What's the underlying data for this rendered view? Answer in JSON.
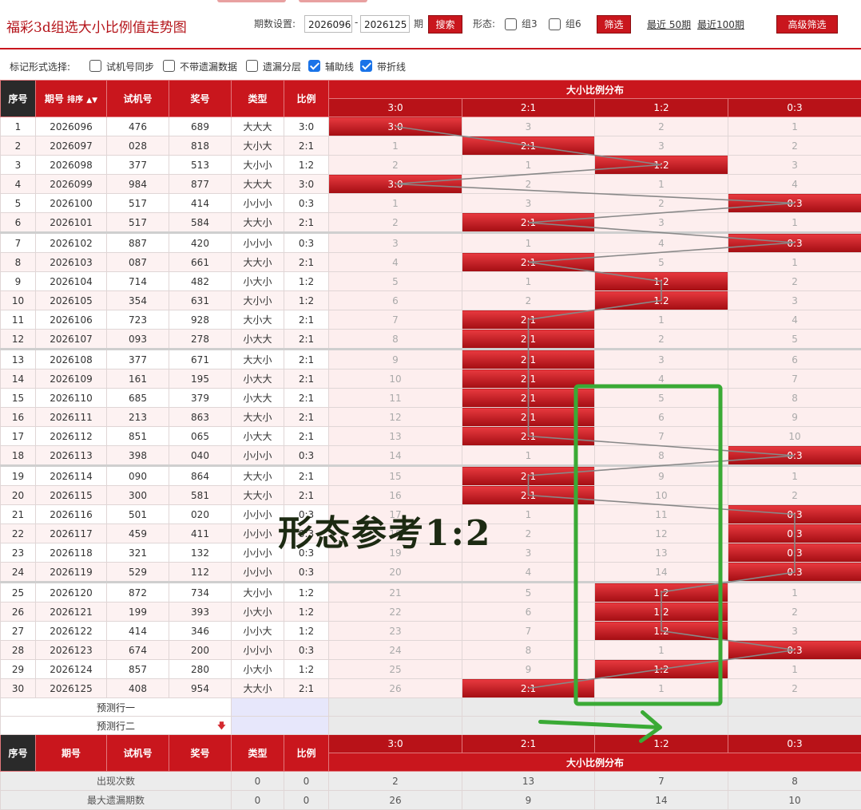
{
  "header": {
    "title": "福彩3d组选大小比例值走势图",
    "period_label": "期数设置:",
    "period_from": "2026096",
    "period_to": "2026125",
    "period_unit": "期",
    "search_label": "搜索",
    "shape_label": "形态:",
    "group3_label": "组3",
    "group6_label": "组6",
    "filter_label": "筛选",
    "recent50": "最近 50期",
    "recent100": "最近100期",
    "advanced_label": "高级筛选"
  },
  "mark_options": {
    "label": "标记形式选择:",
    "items": [
      {
        "label": "试机号同步",
        "checked": false
      },
      {
        "label": "不带遗漏数据",
        "checked": false
      },
      {
        "label": "遗漏分层",
        "checked": false
      },
      {
        "label": "辅助线",
        "checked": true
      },
      {
        "label": "带折线",
        "checked": true
      }
    ]
  },
  "columns": {
    "seq": "序号",
    "period": "期号",
    "sort": "排序",
    "trial": "试机号",
    "draw": "奖号",
    "type": "类型",
    "ratio": "比例",
    "dist": "大小比例分布",
    "ratios": [
      "3:0",
      "2:1",
      "1:2",
      "0:3"
    ]
  },
  "rows": [
    {
      "seq": "1",
      "period": "2026096",
      "trial": "476",
      "draw": "689",
      "type": "大大大",
      "ratio": "3:0",
      "cells": [
        "3:0",
        "3",
        "2",
        "1"
      ],
      "hit": 0
    },
    {
      "seq": "2",
      "period": "2026097",
      "trial": "028",
      "draw": "818",
      "type": "大小大",
      "ratio": "2:1",
      "cells": [
        "1",
        "2:1",
        "3",
        "2"
      ],
      "hit": 1
    },
    {
      "seq": "3",
      "period": "2026098",
      "trial": "377",
      "draw": "513",
      "type": "大小小",
      "ratio": "1:2",
      "cells": [
        "2",
        "1",
        "1:2",
        "3"
      ],
      "hit": 2
    },
    {
      "seq": "4",
      "period": "2026099",
      "trial": "984",
      "draw": "877",
      "type": "大大大",
      "ratio": "3:0",
      "cells": [
        "3:0",
        "2",
        "1",
        "4"
      ],
      "hit": 0
    },
    {
      "seq": "5",
      "period": "2026100",
      "trial": "517",
      "draw": "414",
      "type": "小小小",
      "ratio": "0:3",
      "cells": [
        "1",
        "3",
        "2",
        "0:3"
      ],
      "hit": 3
    },
    {
      "seq": "6",
      "period": "2026101",
      "trial": "517",
      "draw": "584",
      "type": "大大小",
      "ratio": "2:1",
      "cells": [
        "2",
        "2:1",
        "3",
        "1"
      ],
      "hit": 1
    },
    {
      "seq": "7",
      "period": "2026102",
      "trial": "887",
      "draw": "420",
      "type": "小小小",
      "ratio": "0:3",
      "cells": [
        "3",
        "1",
        "4",
        "0:3"
      ],
      "hit": 3
    },
    {
      "seq": "8",
      "period": "2026103",
      "trial": "087",
      "draw": "661",
      "type": "大大小",
      "ratio": "2:1",
      "cells": [
        "4",
        "2:1",
        "5",
        "1"
      ],
      "hit": 1
    },
    {
      "seq": "9",
      "period": "2026104",
      "trial": "714",
      "draw": "482",
      "type": "小大小",
      "ratio": "1:2",
      "cells": [
        "5",
        "1",
        "1:2",
        "2"
      ],
      "hit": 2
    },
    {
      "seq": "10",
      "period": "2026105",
      "trial": "354",
      "draw": "631",
      "type": "大小小",
      "ratio": "1:2",
      "cells": [
        "6",
        "2",
        "1:2",
        "3"
      ],
      "hit": 2
    },
    {
      "seq": "11",
      "period": "2026106",
      "trial": "723",
      "draw": "928",
      "type": "大小大",
      "ratio": "2:1",
      "cells": [
        "7",
        "2:1",
        "1",
        "4"
      ],
      "hit": 1
    },
    {
      "seq": "12",
      "period": "2026107",
      "trial": "093",
      "draw": "278",
      "type": "小大大",
      "ratio": "2:1",
      "cells": [
        "8",
        "2:1",
        "2",
        "5"
      ],
      "hit": 1
    },
    {
      "seq": "13",
      "period": "2026108",
      "trial": "377",
      "draw": "671",
      "type": "大大小",
      "ratio": "2:1",
      "cells": [
        "9",
        "2:1",
        "3",
        "6"
      ],
      "hit": 1
    },
    {
      "seq": "14",
      "period": "2026109",
      "trial": "161",
      "draw": "195",
      "type": "小大大",
      "ratio": "2:1",
      "cells": [
        "10",
        "2:1",
        "4",
        "7"
      ],
      "hit": 1
    },
    {
      "seq": "15",
      "period": "2026110",
      "trial": "685",
      "draw": "379",
      "type": "小大大",
      "ratio": "2:1",
      "cells": [
        "11",
        "2:1",
        "5",
        "8"
      ],
      "hit": 1
    },
    {
      "seq": "16",
      "period": "2026111",
      "trial": "213",
      "draw": "863",
      "type": "大大小",
      "ratio": "2:1",
      "cells": [
        "12",
        "2:1",
        "6",
        "9"
      ],
      "hit": 1
    },
    {
      "seq": "17",
      "period": "2026112",
      "trial": "851",
      "draw": "065",
      "type": "小大大",
      "ratio": "2:1",
      "cells": [
        "13",
        "2:1",
        "7",
        "10"
      ],
      "hit": 1
    },
    {
      "seq": "18",
      "period": "2026113",
      "trial": "398",
      "draw": "040",
      "type": "小小小",
      "ratio": "0:3",
      "cells": [
        "14",
        "1",
        "8",
        "0:3"
      ],
      "hit": 3
    },
    {
      "seq": "19",
      "period": "2026114",
      "trial": "090",
      "draw": "864",
      "type": "大大小",
      "ratio": "2:1",
      "cells": [
        "15",
        "2:1",
        "9",
        "1"
      ],
      "hit": 1
    },
    {
      "seq": "20",
      "period": "2026115",
      "trial": "300",
      "draw": "581",
      "type": "大大小",
      "ratio": "2:1",
      "cells": [
        "16",
        "2:1",
        "10",
        "2"
      ],
      "hit": 1
    },
    {
      "seq": "21",
      "period": "2026116",
      "trial": "501",
      "draw": "020",
      "type": "小小小",
      "ratio": "0:3",
      "cells": [
        "17",
        "1",
        "11",
        "0:3"
      ],
      "hit": 3
    },
    {
      "seq": "22",
      "period": "2026117",
      "trial": "459",
      "draw": "411",
      "type": "小小小",
      "ratio": "0:3",
      "cells": [
        "18",
        "2",
        "12",
        "0:3"
      ],
      "hit": 3
    },
    {
      "seq": "23",
      "period": "2026118",
      "trial": "321",
      "draw": "132",
      "type": "小小小",
      "ratio": "0:3",
      "cells": [
        "19",
        "3",
        "13",
        "0:3"
      ],
      "hit": 3
    },
    {
      "seq": "24",
      "period": "2026119",
      "trial": "529",
      "draw": "112",
      "type": "小小小",
      "ratio": "0:3",
      "cells": [
        "20",
        "4",
        "14",
        "0:3"
      ],
      "hit": 3
    },
    {
      "seq": "25",
      "period": "2026120",
      "trial": "872",
      "draw": "734",
      "type": "大小小",
      "ratio": "1:2",
      "cells": [
        "21",
        "5",
        "1:2",
        "1"
      ],
      "hit": 2
    },
    {
      "seq": "26",
      "period": "2026121",
      "trial": "199",
      "draw": "393",
      "type": "小大小",
      "ratio": "1:2",
      "cells": [
        "22",
        "6",
        "1:2",
        "2"
      ],
      "hit": 2
    },
    {
      "seq": "27",
      "period": "2026122",
      "trial": "414",
      "draw": "346",
      "type": "小小大",
      "ratio": "1:2",
      "cells": [
        "23",
        "7",
        "1:2",
        "3"
      ],
      "hit": 2
    },
    {
      "seq": "28",
      "period": "2026123",
      "trial": "674",
      "draw": "200",
      "type": "小小小",
      "ratio": "0:3",
      "cells": [
        "24",
        "8",
        "1",
        "0:3"
      ],
      "hit": 3
    },
    {
      "seq": "29",
      "period": "2026124",
      "trial": "857",
      "draw": "280",
      "type": "小大小",
      "ratio": "1:2",
      "cells": [
        "25",
        "9",
        "1:2",
        "1"
      ],
      "hit": 2
    },
    {
      "seq": "30",
      "period": "2026125",
      "trial": "408",
      "draw": "954",
      "type": "大大小",
      "ratio": "2:1",
      "cells": [
        "26",
        "2:1",
        "1",
        "2"
      ],
      "hit": 1
    }
  ],
  "predict": [
    "预测行一",
    "预测行二"
  ],
  "stats": {
    "count_label": "出现次数",
    "count_values": [
      "0",
      "0",
      "2",
      "13",
      "7",
      "8"
    ],
    "maxmiss_label": "最大遗漏期数",
    "maxmiss_values": [
      "0",
      "0",
      "26",
      "9",
      "14",
      "10"
    ]
  },
  "annotation": {
    "text": "形态参考1:2",
    "color": "#3aaa35"
  },
  "colors": {
    "brand_red": "#c9161d",
    "hit_red": "#d42a30",
    "trend_line": "#888888",
    "checkbox_blue": "#1a73e8"
  }
}
